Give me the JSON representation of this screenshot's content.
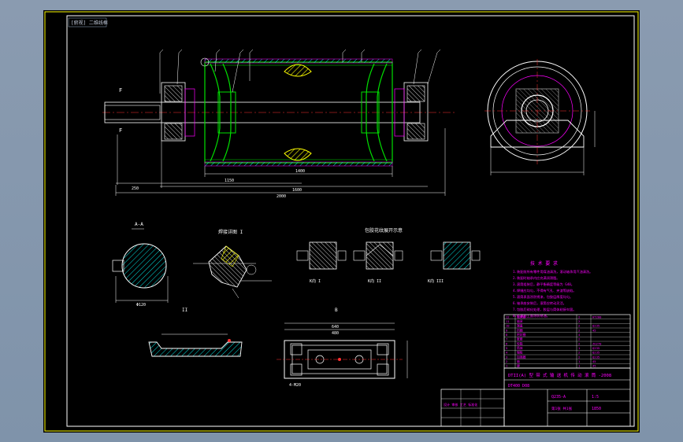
{
  "view_label": "[俯视] 二维线框",
  "tech_req": {
    "title": "技 术 要 求",
    "lines": [
      "1.装配前所有零件用煤油清洗，滚动轴承用汽油清洗。",
      "2.装配时轴承内应充满润滑脂。",
      "3.滚筒组装后，静平衡精度等级为 G40。",
      "4.焊缝应均匀，不得有气孔、夹渣等缺陷。",
      "5.滚筒表面涂防锈漆，包胶层厚度均匀。",
      "6.轴承座安装后，滚筒应转动灵活。",
      "7.包胶后硫化处理，胶层与筒体粘接牢固。",
      "8.外露加工面涂防锈油。"
    ]
  },
  "section_labels": {
    "section_a": "A-A",
    "detail_weld": "焊接详图 I",
    "rubber_patterns": "包胶花纹展开示意",
    "view_b": "B",
    "bearing_housing": "轴承座",
    "detail_ii": "II",
    "view_k1": "K向 I",
    "view_k2": "K向 II",
    "view_k3": "K向 III",
    "bolt_note": "4-M20"
  },
  "title_block": {
    "drawing_title": "DTII(A) 型 带 式 输 送 机 传 动 滚 筒 -2008",
    "part_code": "DT400 D08",
    "scale": "1:5",
    "sheet_info": "第1张 共1张",
    "material": "Q235-A",
    "mass": "1850",
    "company_stamp": "设计 审核 工艺 标准化"
  },
  "parts_table": {
    "rows": [
      [
        "12",
        "轴承座",
        "2",
        "HT200"
      ],
      [
        "11",
        "轴承",
        "2",
        ""
      ],
      [
        "10",
        "端盖",
        "2",
        "Q235"
      ],
      [
        "9",
        "挡圈",
        "2",
        "45"
      ],
      [
        "8",
        "密封圈",
        "4",
        ""
      ],
      [
        "7",
        "胀套",
        "2",
        ""
      ],
      [
        "6",
        "轮毂",
        "2",
        "ZG270"
      ],
      [
        "5",
        "筒体",
        "1",
        "Q235"
      ],
      [
        "4",
        "辐板",
        "2",
        "Q235"
      ],
      [
        "3",
        "加强圈",
        "2",
        "Q235"
      ],
      [
        "2",
        "轴",
        "1",
        "45"
      ],
      [
        "1",
        "键",
        "1",
        "45"
      ]
    ]
  },
  "dimensions": {
    "overall": "2000",
    "body_len": "1400",
    "bearing_span": "1600",
    "shaft_ext": "250",
    "center": "1150",
    "k_dim": "640",
    "base_len": "480",
    "sec_dia": "Φ120"
  },
  "colors": {
    "bg": "#000000",
    "line_white": "#ffffff",
    "line_green": "#00e000",
    "line_yellow": "#ffff00",
    "line_red": "#ff3030",
    "line_magenta": "#ff00ff",
    "line_cyan": "#00e0e0"
  }
}
